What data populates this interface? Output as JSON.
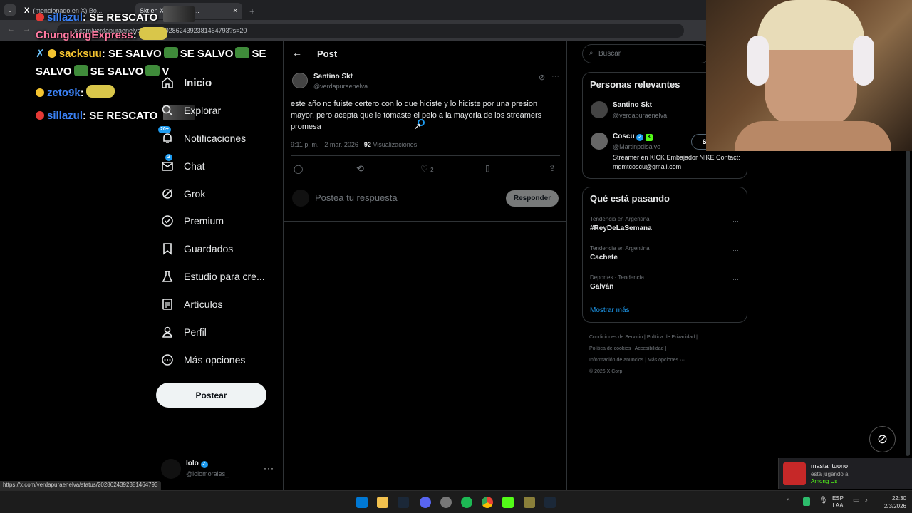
{
  "browser": {
    "tabs": [
      {
        "label": "(mencionado en X) Bo..."
      },
      {
        "label": "Skt en X: \"@Martin..."
      }
    ],
    "url": "x.com/verdapuraenelva/status/2028624392381464793?s=20",
    "status_url": "https://x.com/verdapuraenelva/status/2028624392381464793"
  },
  "stream_chat": [
    {
      "user": "sillazul",
      "message": "SE RESCATO",
      "color": "#3b82f6"
    },
    {
      "user": "ChungkingExpress",
      "message": "",
      "color": "#ff7aa2"
    },
    {
      "user": "sacksuu",
      "message": "SE SALVO",
      "repeat": "SE SALVO",
      "line2": "SALVO",
      "line2b": "SE SALVO",
      "line2c": "V",
      "line1c": "SE",
      "color": "#f4c430"
    },
    {
      "user": "zeto9k",
      "message": "",
      "color": "#3b82f6"
    },
    {
      "user": "sillazul",
      "message": "SE RESCATO",
      "color": "#3b82f6"
    }
  ],
  "sidebar": {
    "items": [
      {
        "label": "Inicio",
        "icon": "home-icon"
      },
      {
        "label": "Explorar",
        "icon": "search-icon"
      },
      {
        "label": "Notificaciones",
        "icon": "bell-icon",
        "badge": "20+"
      },
      {
        "label": "Chat",
        "icon": "mail-icon",
        "badge": "2"
      },
      {
        "label": "Grok",
        "icon": "grok-icon"
      },
      {
        "label": "Premium",
        "icon": "verified-icon"
      },
      {
        "label": "Guardados",
        "icon": "bookmark-icon"
      },
      {
        "label": "Estudio para cre...",
        "icon": "flask-icon"
      },
      {
        "label": "Artículos",
        "icon": "article-icon"
      },
      {
        "label": "Perfil",
        "icon": "person-icon"
      },
      {
        "label": "Más opciones",
        "icon": "more-circle-icon"
      }
    ],
    "post_button": "Postear",
    "account": {
      "name": "lolo",
      "handle": "@lolomorales_"
    }
  },
  "post": {
    "header_title": "Post",
    "author_name": "Santino Skt",
    "author_handle": "@verdapuraenelva",
    "text": "este año no fuiste certero con lo que hiciste y lo hiciste por una presion mayor, pero acepta que le tomaste el pelo a la mayoria de los streamers promesa",
    "timestamp": "9:11 p. m. · 2 mar. 2026 ·",
    "views_count": "92",
    "views_label": "Visualizaciones",
    "likes": "2",
    "reply_placeholder": "Postea tu respuesta",
    "reply_button": "Responder"
  },
  "right": {
    "search_placeholder": "Buscar",
    "relevant_title": "Personas relevantes",
    "people": [
      {
        "name": "Santino Skt",
        "handle": "@verdapuraenelva"
      },
      {
        "name": "Coscu",
        "handle": "@Martinpdisalvo",
        "bio": "Streamer en KICK Embajador NIKE Contact: mgmtcoscu@gmail.com",
        "follow": "Si"
      }
    ],
    "trends_title": "Qué está pasando",
    "trends": [
      {
        "context": "Tendencia en Argentina",
        "name": "#ReyDeLaSemana"
      },
      {
        "context": "Tendencia en Argentina",
        "name": "Cachete"
      },
      {
        "context": "Deportes · Tendencia",
        "name": "Galván"
      }
    ],
    "show_more": "Mostrar más",
    "footer_links": [
      "Condiciones de Servicio",
      "Política de Privacidad",
      "Política de cookies",
      "Accesibilidad",
      "Información de anuncios",
      "Más opciones ···"
    ],
    "copyright": "© 2026 X Corp."
  },
  "notification": {
    "user": "mastantuono",
    "status": "está jugando a",
    "game": "Among Us"
  },
  "taskbar": {
    "lang1": "ESP",
    "lang2": "LAA",
    "time": "22:30",
    "date": "2/3/2026"
  },
  "colors": {
    "accent": "#1d9bf0",
    "kick": "#53fc18"
  }
}
